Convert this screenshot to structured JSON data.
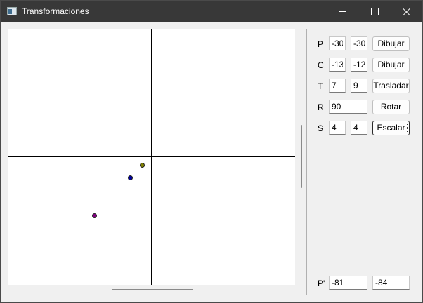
{
  "window": {
    "title": "Transformaciones",
    "icon": "app-window-icon",
    "controls": [
      "minimize-icon",
      "maximize-icon",
      "close-icon"
    ]
  },
  "canvas": {
    "points": [
      {
        "name": "olive-point",
        "color": "#808000"
      },
      {
        "name": "blue-point",
        "color": "#0000a0"
      },
      {
        "name": "purple-point",
        "color": "#800080"
      }
    ]
  },
  "controls": {
    "p": {
      "label": "P",
      "x": "-30",
      "y": "-30",
      "button": "Dibujar"
    },
    "c": {
      "label": "C",
      "x": "-13",
      "y": "-12",
      "button": "Dibujar"
    },
    "t": {
      "label": "T",
      "x": "7",
      "y": "9",
      "button": "Trasladar"
    },
    "r": {
      "label": "R",
      "angle": "90",
      "button": "Rotar"
    },
    "s": {
      "label": "S",
      "x": "4",
      "y": "4",
      "button": "Escalar"
    },
    "p_prime": {
      "label": "P'",
      "x": "-81",
      "y": "-84"
    }
  }
}
